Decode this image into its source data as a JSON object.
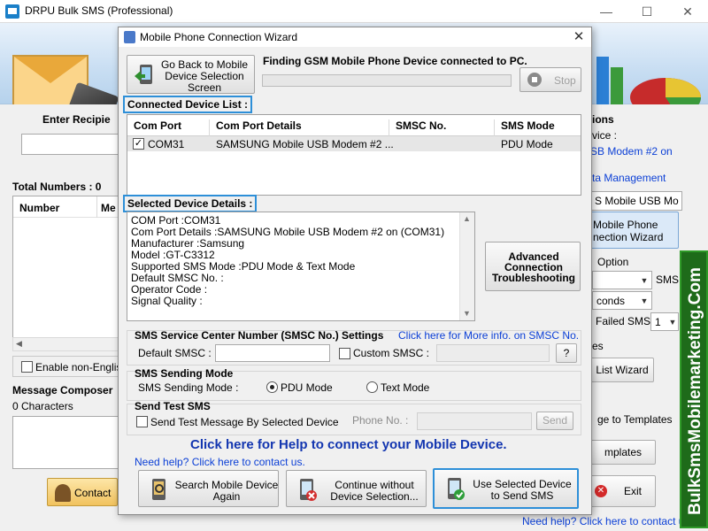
{
  "main": {
    "title": "DRPU Bulk SMS (Professional)",
    "enter_recipient": "Enter Recipie",
    "total_numbers": "Total Numbers : 0",
    "col_number": "Number",
    "col_me": "Me",
    "enable_non_english": "Enable non-Englis",
    "message_composer": "Message Composer",
    "characters": "0 Characters",
    "contact_button": "Contact",
    "right": {
      "options": "ions",
      "device": "vice :",
      "modem": "SB Modem #2 on",
      "data_management": "ta Management",
      "sb_mobile": "S Mobile USB Mo",
      "mobile_phone_wizard_1": "Mobile Phone",
      "mobile_phone_wizard_2": "nection  Wizard",
      "option": "Option",
      "sms": "SMS",
      "seconds": "conds",
      "failed_sms": "Failed SMS",
      "failed_value": "1",
      "es": "es",
      "list_wizard": "List Wizard",
      "ge_to_templates": "ge to Templates",
      "templates": "mplates",
      "exit": "Exit",
      "need_help": "Need help? Click here to contact us"
    },
    "watermark": "BulkSmsMobilemarketing.Com"
  },
  "dialog": {
    "title": "Mobile Phone Connection Wizard",
    "go_back": "Go Back to Mobile Device Selection Screen",
    "finding": "Finding GSM Mobile Phone Device connected to PC.",
    "stop": "Stop",
    "connected_list_label": "Connected Device List :",
    "columns": [
      "Com Port",
      "Com Port Details",
      "SMSC No.",
      "SMS Mode"
    ],
    "row": {
      "com_port": "COM31",
      "details": "SAMSUNG Mobile USB Modem #2 ...",
      "smsc": "",
      "mode": "PDU Mode"
    },
    "selected_details_label": "Selected Device Details :",
    "details": [
      "COM Port :COM31",
      "Com Port Details :SAMSUNG Mobile USB Modem #2 on (COM31)",
      "Manufacturer :Samsung",
      "Model :GT-C3312",
      "Supported SMS Mode :PDU Mode & Text Mode",
      "Default SMSC No. :",
      "Operator Code :",
      "Signal Quality :"
    ],
    "advanced": "Advanced Connection Troubleshooting",
    "smsc_settings": "SMS Service Center Number (SMSC No.) Settings",
    "smsc_link": "Click here for More info. on SMSC No.",
    "default_smsc": "Default SMSC :",
    "custom_smsc": "Custom SMSC :",
    "question": "?",
    "sending_mode_title": "SMS Sending Mode",
    "sending_mode_label": "SMS Sending Mode :",
    "pdu_mode": "PDU Mode",
    "text_mode": "Text Mode",
    "send_test_title": "Send Test SMS",
    "send_test_check": "Send Test Message By Selected Device",
    "phone_no": "Phone No. :",
    "send": "Send",
    "help_banner": "Click here for Help to connect your Mobile Device.",
    "need_help": "Need help? Click here to contact us.",
    "search_again": "Search Mobile Device Again",
    "continue_without": "Continue without Device Selection...",
    "use_selected": "Use Selected Device to Send SMS"
  },
  "colors": {
    "accent": "#2d8fd8",
    "link": "#0b3fd6",
    "watermark_bg": "#1e6b1a"
  }
}
